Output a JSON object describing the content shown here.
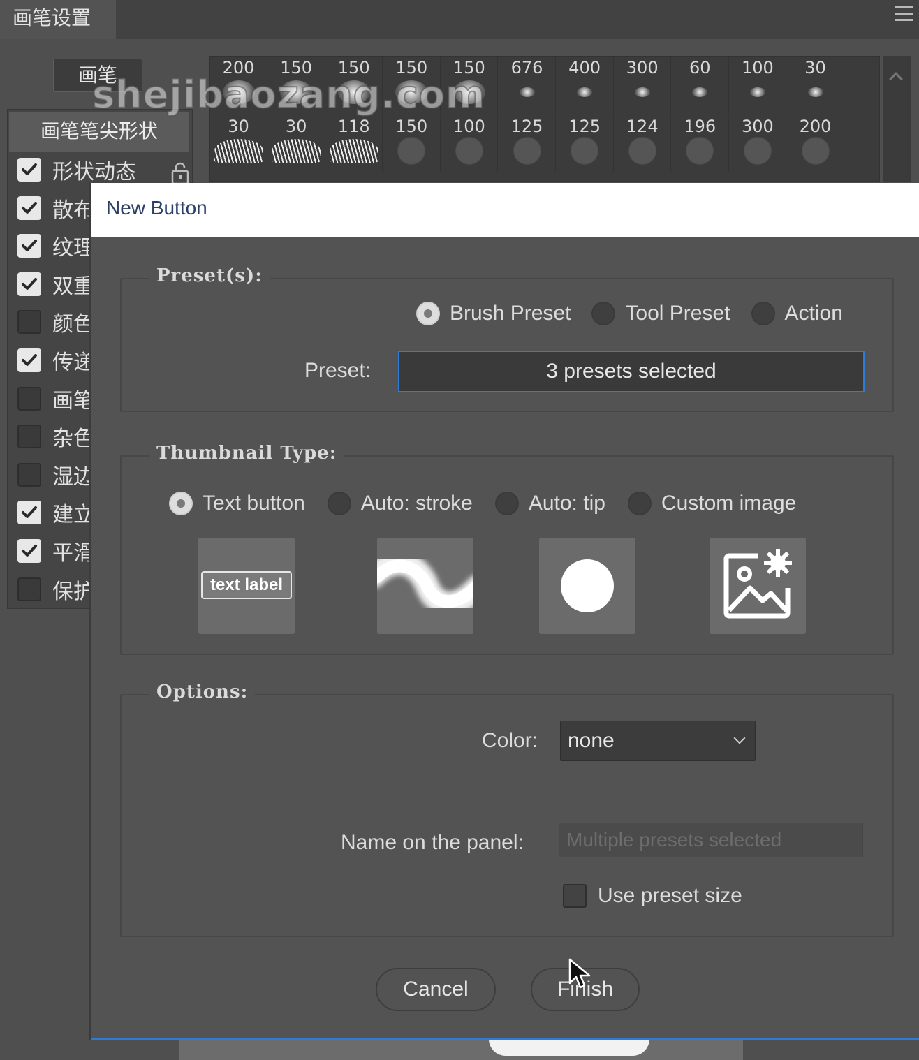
{
  "panel": {
    "tab_title": "画笔设置",
    "brush_button": "画笔",
    "tip_shape": "画笔笔尖形状",
    "settings": [
      {
        "label": "形状动态",
        "checked": true
      },
      {
        "label": "散布",
        "checked": true
      },
      {
        "label": "纹理",
        "checked": true
      },
      {
        "label": "双重",
        "checked": true
      },
      {
        "label": "颜色",
        "checked": false
      },
      {
        "label": "传递",
        "checked": true
      },
      {
        "label": "画笔",
        "checked": false
      },
      {
        "label": "杂色",
        "checked": false
      },
      {
        "label": "湿边",
        "checked": false
      },
      {
        "label": "建立",
        "checked": true
      },
      {
        "label": "平滑",
        "checked": true
      },
      {
        "label": "保护",
        "checked": false
      }
    ],
    "preset_sizes_row0": [
      "200",
      "150",
      "150",
      "150",
      "150",
      "676",
      "400",
      "300",
      "60",
      "100",
      "30"
    ],
    "preset_sizes_row1": [
      "30",
      "30",
      "118",
      "150",
      "100",
      "125",
      "125",
      "124",
      "196",
      "300",
      "200"
    ],
    "watermark": "shejibaozang.com"
  },
  "dialog": {
    "title": "New Button",
    "presets_group": {
      "legend": "Preset(s):",
      "options": [
        "Brush Preset",
        "Tool Preset",
        "Action"
      ],
      "selected": "Brush Preset",
      "preset_label": "Preset:",
      "preset_value": "3 presets selected"
    },
    "thumbnail_group": {
      "legend": "Thumbnail Type:",
      "options": [
        "Text button",
        "Auto: stroke",
        "Auto: tip",
        "Custom image"
      ],
      "selected": "Text button",
      "text_chip": "text label"
    },
    "options_group": {
      "legend": "Options:",
      "color_label": "Color:",
      "color_value": "none",
      "name_label": "Name on the panel:",
      "name_placeholder": "Multiple presets selected",
      "use_preset_size_label": "Use preset size",
      "use_preset_size_checked": false
    },
    "buttons": {
      "cancel": "Cancel",
      "finish": "Finish"
    }
  },
  "colors": {
    "accent": "#2e7cd6",
    "dialog_bg": "#535353",
    "titlebar_bg": "#ffffff"
  }
}
